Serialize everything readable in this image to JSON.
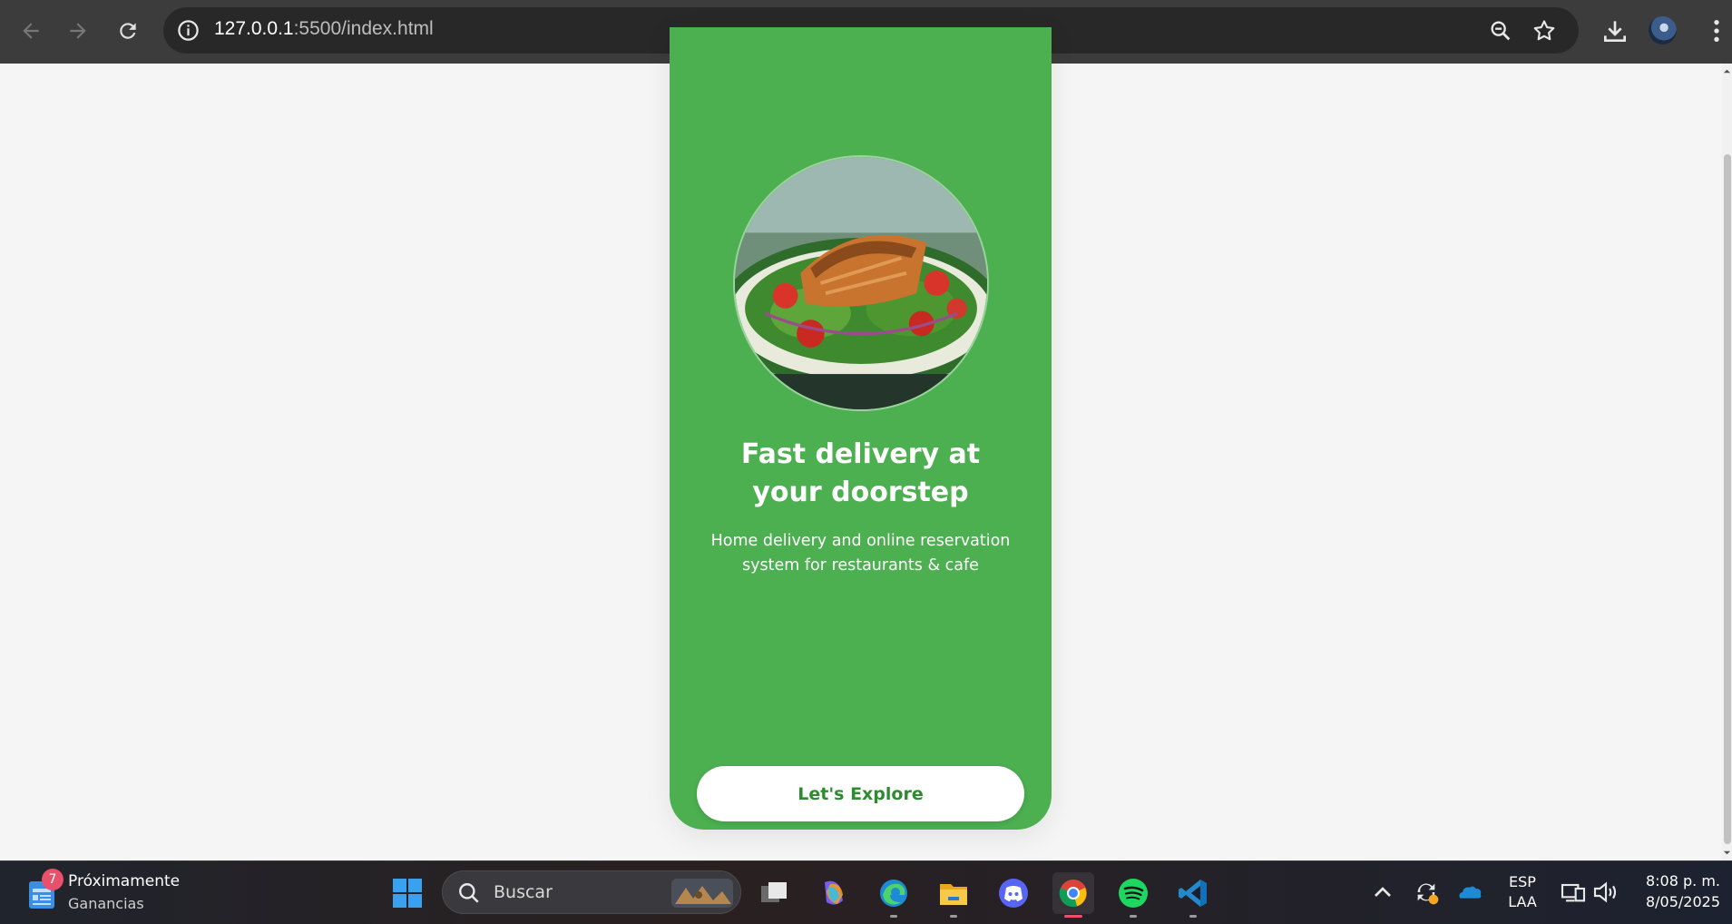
{
  "browser": {
    "url_host": "127.0.0.1",
    "url_rest": ":5500/index.html",
    "icons": {
      "back": "back-arrow-icon",
      "forward": "forward-arrow-icon",
      "reload": "reload-icon",
      "site_info": "info-icon",
      "zoom": "zoom-icon",
      "bookmark": "star-icon",
      "download": "download-icon",
      "menu": "kebab-menu-icon"
    }
  },
  "page": {
    "headline_line1": "Fast delivery at",
    "headline_line2": "your doorstep",
    "subtitle_line1": "Home delivery and online reservation",
    "subtitle_line2": "system for restaurants & cafe",
    "cta_label": "Let's Explore",
    "card_color": "#4caf50",
    "cta_text_color": "#2e8b30"
  },
  "taskbar": {
    "widget_badge": "7",
    "widget_title": "Próximamente",
    "widget_subtitle": "Ganancias",
    "search_placeholder": "Buscar",
    "apps": [
      "windows-start-icon",
      "task-view-icon",
      "copilot-icon",
      "edge-icon",
      "file-explorer-icon",
      "discord-icon",
      "chrome-icon",
      "spotify-icon",
      "vscode-icon"
    ],
    "active_app": "chrome-icon",
    "tray": {
      "lang_line1": "ESP",
      "lang_line2": "LAA",
      "time": "8:08 p. m.",
      "date": "8/05/2025"
    }
  }
}
